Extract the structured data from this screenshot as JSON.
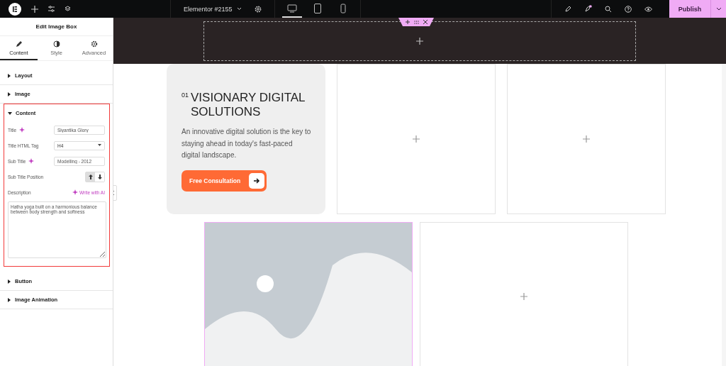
{
  "topbar": {
    "document_title": "Elementor #2155",
    "devices": [
      {
        "kind": "desktop",
        "selected": true
      },
      {
        "kind": "tablet",
        "selected": false
      },
      {
        "kind": "mobile",
        "selected": false
      }
    ],
    "notification": true,
    "publish": "Publish"
  },
  "panel": {
    "title": "Edit Image Box",
    "tabs": [
      {
        "label": "Content",
        "kind": "pencil",
        "selected": true
      },
      {
        "label": "Style",
        "kind": "contrast",
        "selected": false
      },
      {
        "label": "Advanced",
        "kind": "gear",
        "selected": false
      }
    ],
    "sections": [
      {
        "label": "Layout",
        "expanded": false
      },
      {
        "label": "Image",
        "expanded": false
      },
      {
        "label": "Content",
        "expanded": true,
        "highlighted": true,
        "controls": [
          {
            "kind": "text",
            "label": "Title",
            "ai": true,
            "value": "Siyantika Glory"
          },
          {
            "kind": "select",
            "label": "Title HTML Tag",
            "value": "H4"
          },
          {
            "kind": "text",
            "label": "Sub Title",
            "ai": true,
            "value": "Modelling - 2012"
          },
          {
            "kind": "choice",
            "label": "Sub Title Position",
            "options": [
              {
                "kind": "up",
                "selected": true
              },
              {
                "kind": "down",
                "selected": false
              }
            ]
          },
          {
            "kind": "textarea",
            "label": "Description",
            "ai_link": "Write with AI",
            "value": "Hatha yoga built on a harmonious balance between body strength and softness"
          }
        ]
      },
      {
        "label": "Button",
        "expanded": false
      },
      {
        "label": "Image Animation",
        "expanded": false
      }
    ]
  },
  "canvas": {
    "card": {
      "number": "01",
      "title": "VISIONARY DIGITAL SOLUTIONS",
      "description": "An innovative digital solution is the key to staying ahead in today's fast-paced digital landscape.",
      "button": "Free Consultation"
    },
    "image_box": {
      "selected": true
    }
  }
}
